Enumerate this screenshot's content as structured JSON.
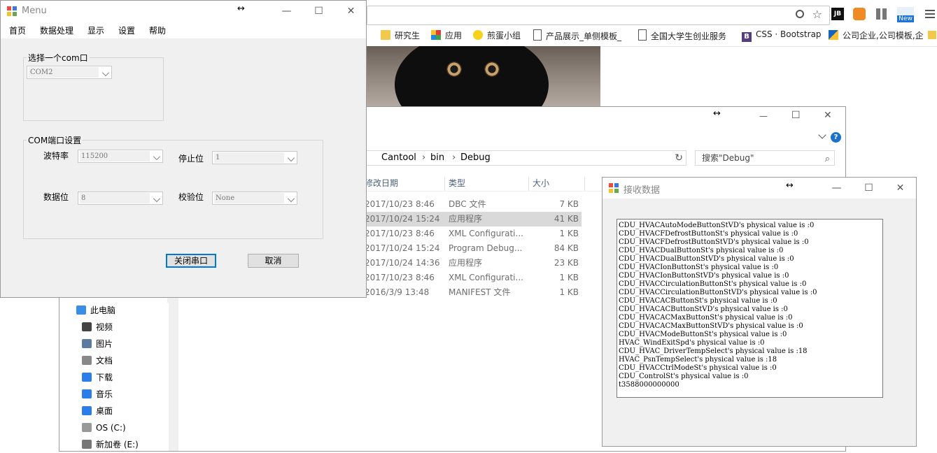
{
  "browser": {
    "bookmarks": [
      "研究生",
      "应用",
      "煎蛋小组",
      "产品展示_单侧模板_",
      "全国大学生创业服务",
      "CSS · Bootstrap",
      "公司企业,公司模板,企"
    ],
    "ext_badge": "New",
    "ext_label": "JB"
  },
  "explorer": {
    "breadcrumb": [
      "Cantool",
      "bin",
      "Debug"
    ],
    "search_placeholder": "搜索\"Debug\"",
    "columns": [
      "修改日期",
      "类型",
      "大小"
    ],
    "rows": [
      {
        "date": "2017/10/23 8:46",
        "type": "DBC 文件",
        "size": "7 KB"
      },
      {
        "date": "2017/10/24 15:24",
        "type": "应用程序",
        "size": "41 KB"
      },
      {
        "date": "2017/10/23 8:46",
        "type": "XML Configurati...",
        "size": "1 KB"
      },
      {
        "date": "2017/10/24 15:24",
        "type": "Program Debug...",
        "size": "84 KB"
      },
      {
        "date": "2017/10/24 14:36",
        "type": "应用程序",
        "size": "23 KB"
      },
      {
        "date": "2017/10/23 8:46",
        "type": "XML Configurati...",
        "size": "1 KB"
      },
      {
        "date": "2016/3/9 13:48",
        "type": "MANIFEST 文件",
        "size": "1 KB"
      }
    ],
    "nav": [
      "此电脑",
      "视频",
      "图片",
      "文档",
      "下载",
      "音乐",
      "桌面",
      "OS (C:)",
      "新加卷 (E:)"
    ]
  },
  "menu_window": {
    "title": "Menu",
    "menus": [
      "首页",
      "数据处理",
      "显示",
      "设置",
      "帮助"
    ],
    "com_group": "选择一个com口",
    "com_value": "COM2",
    "settings_group": "COM端口设置",
    "baud_label": "波特率",
    "baud_value": "115200",
    "stop_label": "停止位",
    "stop_value": "1",
    "data_label": "数据位",
    "data_value": "8",
    "parity_label": "校验位",
    "parity_value": "None",
    "close_port": "关闭串口",
    "cancel": "取消"
  },
  "recv_window": {
    "title": "接收数据",
    "text": "CDU_HVACAutoModeButtonStVD's physical value is :0\nCDU_HVACFDefrostButtonSt's physical value is :0\nCDU_HVACFDefrostButtonStVD's physical value is :0\nCDU_HVACDualButtonSt's physical value is :0\nCDU_HVACDualButtonStVD's physical value is :0\nCDU_HVACIonButtonSt's physical value is :0\nCDU_HVACIonButtonStVD's physical value is :0\nCDU_HVACCirculationButtonSt's physical value is :0\nCDU_HVACCirculationButtonStVD's physical value is :0\nCDU_HVACACButtonSt's physical value is :0\nCDU_HVACACButtonStVD's physical value is :0\nCDU_HVACACMaxButtonSt's physical value is :0\nCDU_HVACACMaxButtonStVD's physical value is :0\nCDU_HVACModeButtonSt's physical value is :0\nHVAC_WindExitSpd's physical value is :0\nCDU_HVAC_DriverTempSelect's physical value is :18\nHVAC_PsnTempSelect's physical value is :18\nCDU_HVACCtrlModeSt's physical value is :0\nCDU_ControlSt's physical value is :0\nt3588000000000"
  },
  "window_controls": {
    "minimize": "—",
    "maximize": "☐",
    "close": "✕",
    "move": "↔"
  }
}
